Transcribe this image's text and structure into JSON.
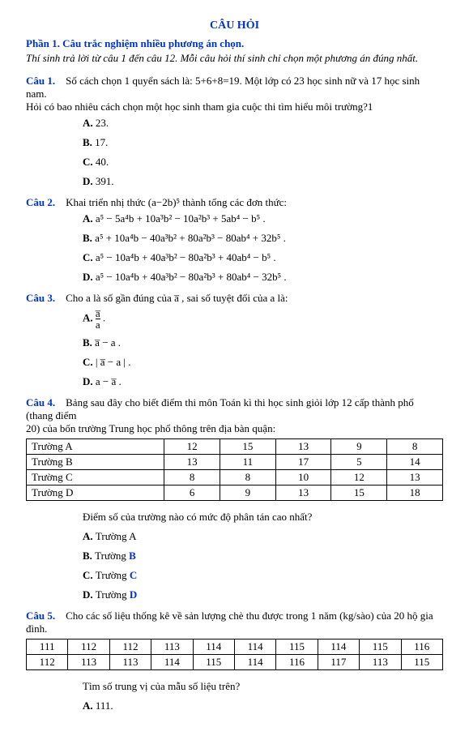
{
  "title": "CÂU HỎI",
  "part1_heading": "Phần 1. Câu trắc nghiệm nhiều phương án chọn.",
  "instruction": "Thí sinh trả lời từ câu 1 đến câu 12. Mỗi câu hỏi thí sinh chỉ chọn một phương án đúng nhất.",
  "q1": {
    "label": "Câu 1.",
    "text1": "Số cách chọn 1 quyển sách là: 5+6+8=19. Một lớp có 23 học sinh nữ và 17 học sinh nam.",
    "text2": "Hỏi có bao nhiêu cách chọn một học sinh tham gia cuộc thi tìm hiểu môi trường?1",
    "A": "23.",
    "B": "17.",
    "C": "40.",
    "D": "391."
  },
  "q2": {
    "label": "Câu 2.",
    "text": "Khai triển nhị thức (a−2b)⁵ thành tổng các đơn thức:",
    "A": "a⁵ − 5a⁴b + 10a³b² − 10a²b³ + 5ab⁴ − b⁵ .",
    "B": "a⁵ + 10a⁴b − 40a³b² + 80a²b³ − 80ab⁴ + 32b⁵ .",
    "C": "a⁵ − 10a⁴b + 40a³b² − 80a²b³ + 40ab⁴ − b⁵ .",
    "D": "a⁵ − 10a⁴b + 40a³b² − 80a²b³ + 80ab⁴ − 32b⁵ ."
  },
  "q3": {
    "label": "Câu 3.",
    "text": "Cho a là số gần đúng của a̅ , sai số tuyệt đối của a là:",
    "A": "a̅ / a .",
    "B": "a̅ − a .",
    "C": "| a̅ − a | .",
    "D": "a − a̅ ."
  },
  "q4": {
    "label": "Câu 4.",
    "intro1": "Bảng sau đây cho biết điểm thi môn Toán kì thi học sinh giỏi lớp 12 cấp thành phố (thang điểm",
    "intro2": "20) của bốn trường Trung học phổ thông trên địa bàn quận:",
    "rows": [
      {
        "label": "Trường A",
        "c1": "12",
        "c2": "15",
        "c3": "13",
        "c4": "9",
        "c5": "8"
      },
      {
        "label": "Trường B",
        "c1": "13",
        "c2": "11",
        "c3": "17",
        "c4": "5",
        "c5": "14"
      },
      {
        "label": "Trường C",
        "c1": "8",
        "c2": "8",
        "c3": "10",
        "c4": "12",
        "c5": "13"
      },
      {
        "label": "Trường D",
        "c1": "6",
        "c2": "9",
        "c3": "13",
        "c4": "15",
        "c5": "18"
      }
    ],
    "prompt": "Điểm số của trường nào có mức độ phân tán cao nhất?",
    "A": "Trường A",
    "B": "Trường B",
    "C": "Trường C",
    "D": "Trường D"
  },
  "q5": {
    "label": "Câu 5.",
    "text": "Cho các số liệu thống kê về sản lượng chè thu được trong 1 năm (kg/sào) của 20 hộ gia đình.",
    "row1": [
      "111",
      "112",
      "112",
      "113",
      "114",
      "114",
      "115",
      "114",
      "115",
      "116"
    ],
    "row2": [
      "112",
      "113",
      "113",
      "114",
      "115",
      "114",
      "116",
      "117",
      "113",
      "115"
    ],
    "prompt": "Tìm số trung vị của mẫu số liệu trên?",
    "A": "111."
  }
}
